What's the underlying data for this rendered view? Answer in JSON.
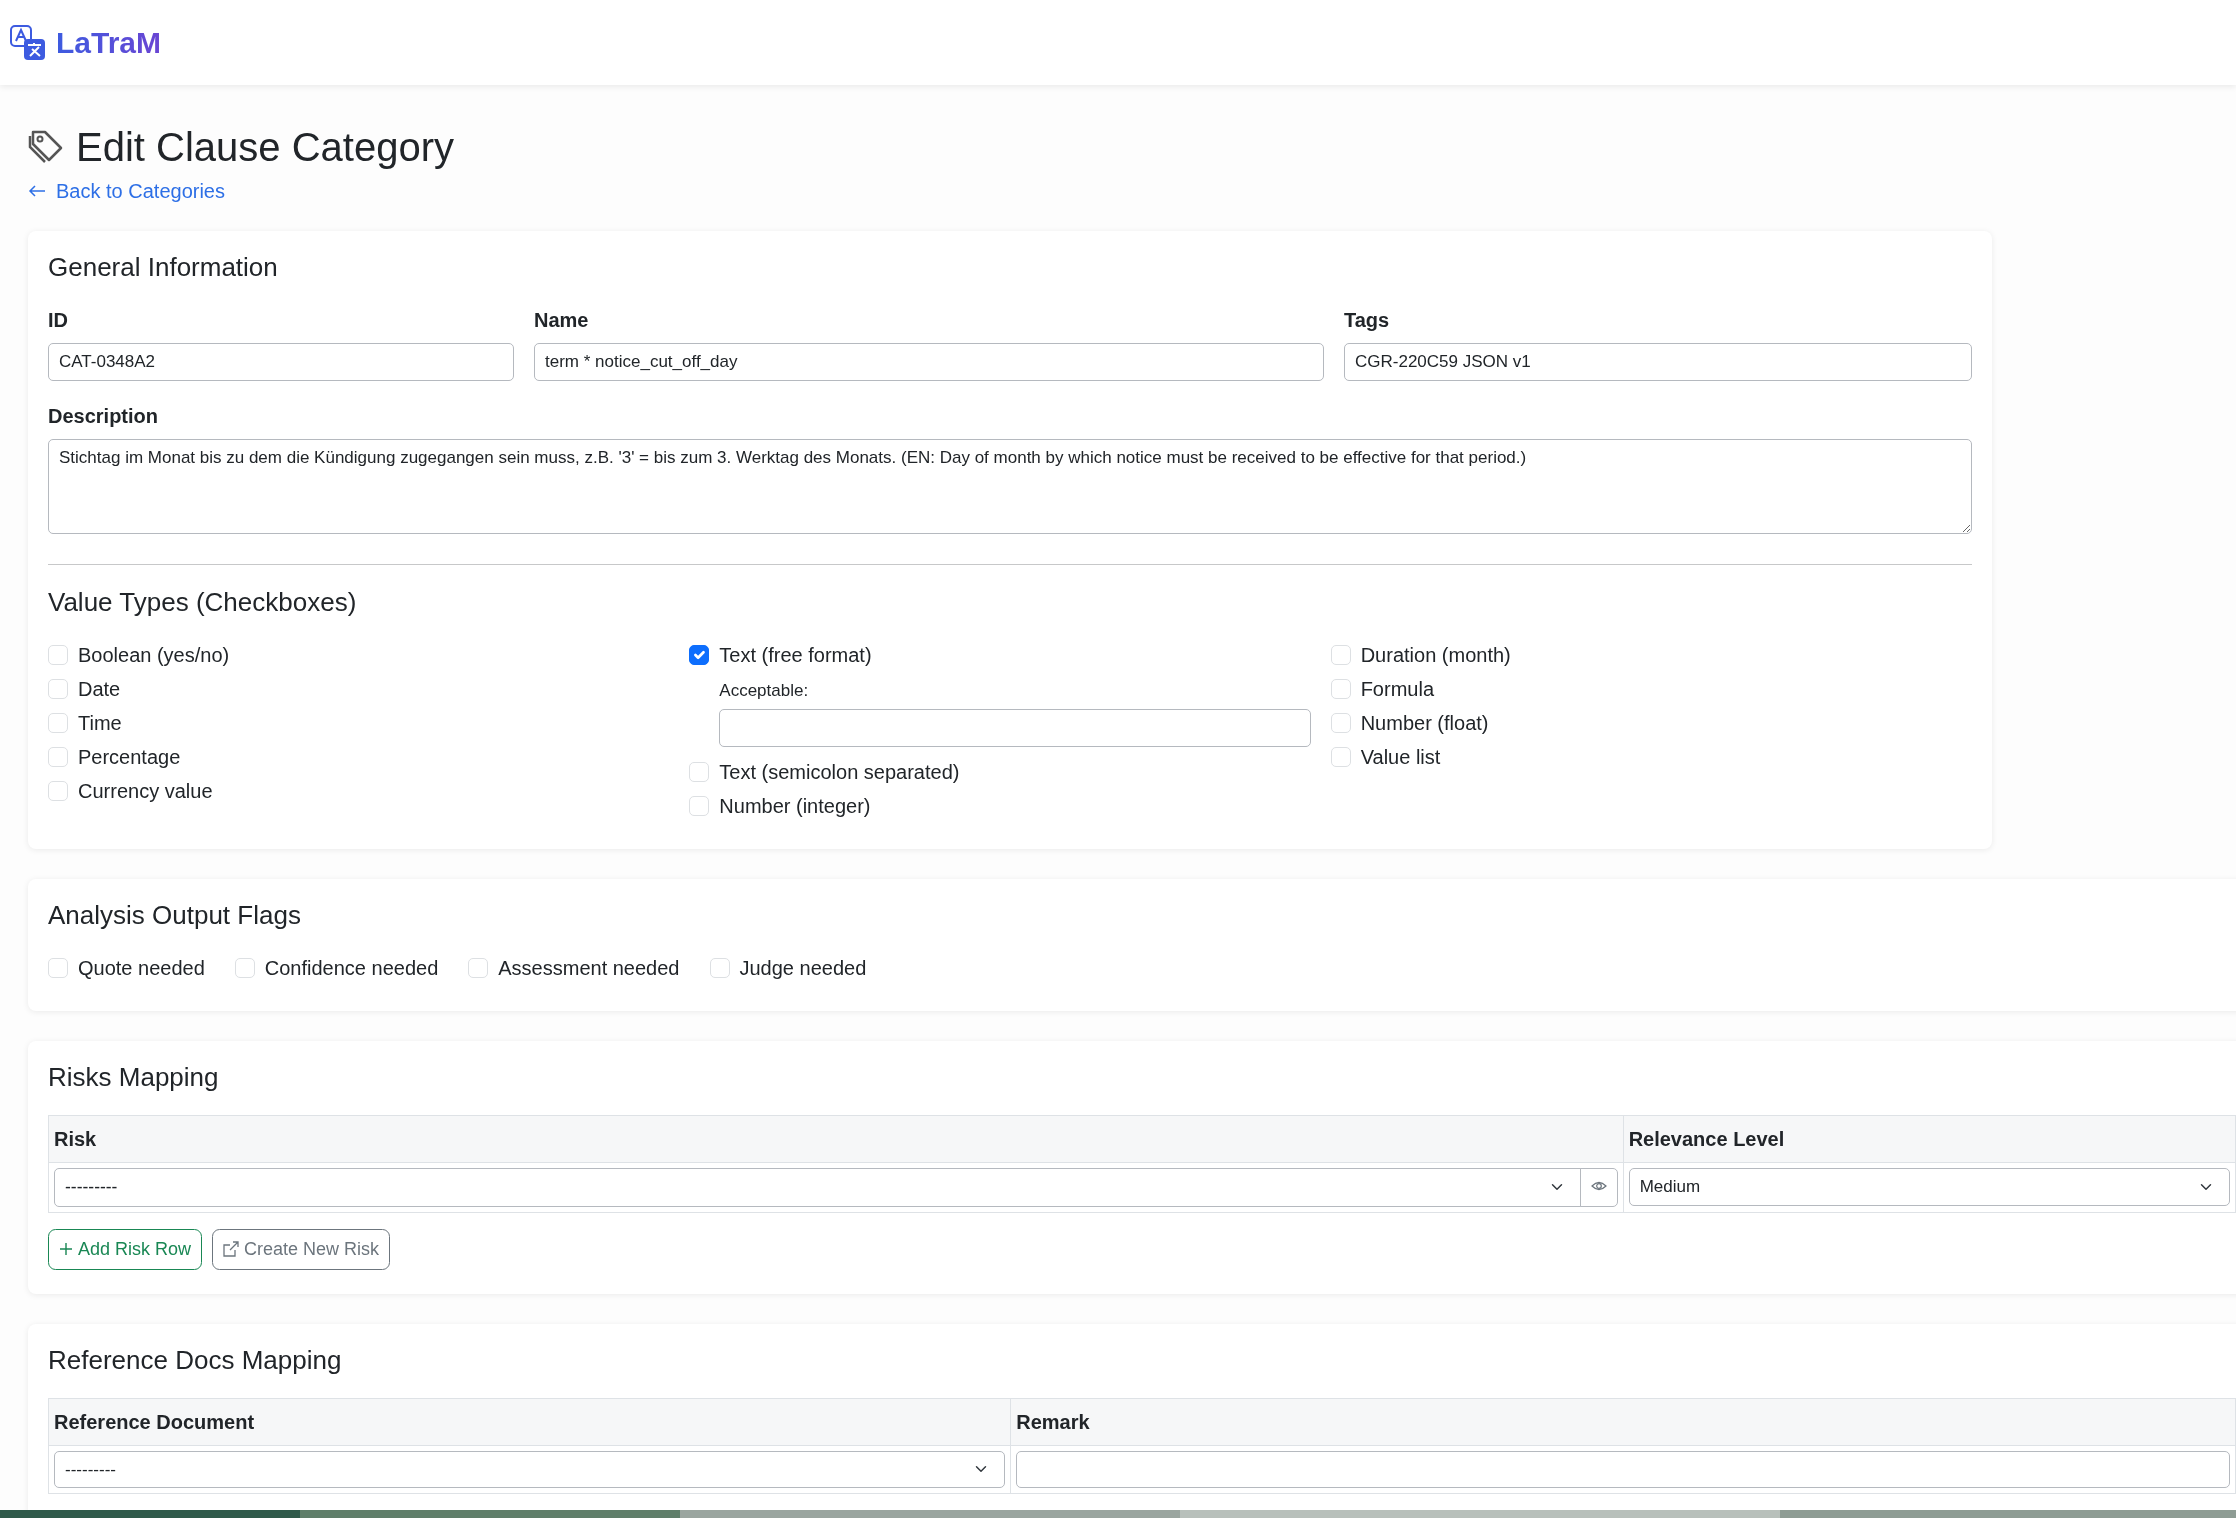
{
  "app": {
    "name": "LaTraM"
  },
  "page": {
    "title": "Edit Clause Category",
    "back_link": "Back to Categories"
  },
  "general": {
    "title": "General Information",
    "fields": [
      {
        "label": "ID",
        "value": "CAT-0348A2"
      },
      {
        "label": "Name",
        "value": "term * notice_cut_off_day"
      },
      {
        "label": "Tags",
        "value": "CGR-220C59 JSON v1"
      }
    ],
    "description": {
      "label": "Description",
      "value": "Stichtag im Monat bis zu dem die Kündigung zugegangen sein muss, z.B. '3' = bis zum 3. Werktag des Monats. (EN: Day of month by which notice must be received to be effective for that period.)"
    }
  },
  "value_types": {
    "title": "Value Types (Checkboxes)",
    "columns": [
      [
        {
          "label": "Boolean (yes/no)",
          "checked": false
        },
        {
          "label": "Date",
          "checked": false
        },
        {
          "label": "Time",
          "checked": false
        },
        {
          "label": "Percentage",
          "checked": false
        },
        {
          "label": "Currency value",
          "checked": false
        }
      ],
      [
        {
          "label": "Text (free format)",
          "checked": true,
          "sub_field": {
            "label": "Acceptable:"
          }
        },
        {
          "label": "Text (semicolon separated)",
          "checked": false
        },
        {
          "label": "Number (integer)",
          "checked": false
        }
      ],
      [
        {
          "label": "Duration (month)",
          "checked": false
        },
        {
          "label": "Formula",
          "checked": false
        },
        {
          "label": "Number (float)",
          "checked": false
        },
        {
          "label": "Value list",
          "checked": false
        }
      ]
    ]
  },
  "flags": {
    "title": "Analysis Output Flags",
    "items": [
      {
        "label": "Quote needed",
        "checked": false
      },
      {
        "label": "Confidence needed",
        "checked": false
      },
      {
        "label": "Assessment needed",
        "checked": false
      },
      {
        "label": "Judge needed",
        "checked": false
      }
    ]
  },
  "risks": {
    "title": "Risks Mapping",
    "columns": [
      "Risk",
      "Relevance Level"
    ],
    "rows": [
      {
        "risk": "---------",
        "relevance": "Medium"
      }
    ],
    "buttons": [
      {
        "label": "Add Risk Row",
        "kind": "add"
      },
      {
        "label": "Create New Risk",
        "kind": "external"
      }
    ]
  },
  "reference_docs": {
    "title": "Reference Docs Mapping",
    "columns": [
      "Reference Document",
      "Remark"
    ],
    "rows": [
      {
        "document": "---------"
      }
    ]
  }
}
